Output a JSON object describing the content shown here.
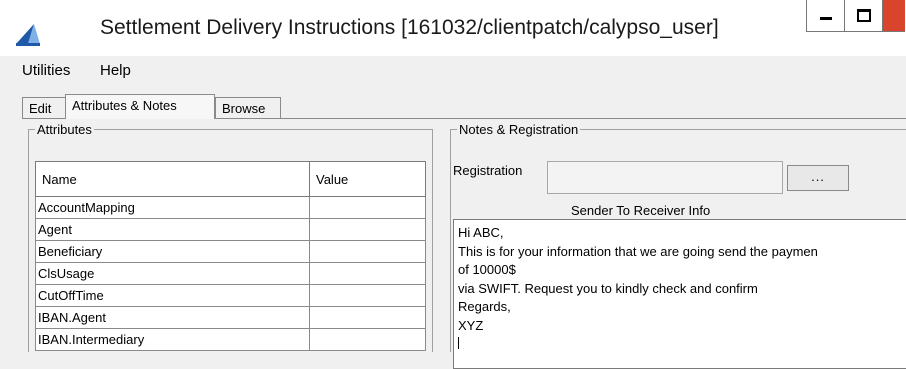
{
  "window": {
    "title": "Settlement Delivery Instructions  [161032/clientpatch/calypso_user]",
    "accent_color": "#1e5aa8",
    "close_color": "#d9452c"
  },
  "menu": {
    "items": [
      "Utilities",
      "Help"
    ]
  },
  "tabs": [
    {
      "label": "Edit",
      "active": false
    },
    {
      "label": "Attributes & Notes",
      "active": true
    },
    {
      "label": "Browse",
      "active": false
    }
  ],
  "attributes": {
    "group_title": "Attributes",
    "columns": [
      "Name",
      "Value"
    ],
    "rows": [
      {
        "name": "AccountMapping",
        "value": ""
      },
      {
        "name": "Agent",
        "value": ""
      },
      {
        "name": "Beneficiary",
        "value": ""
      },
      {
        "name": "ClsUsage",
        "value": ""
      },
      {
        "name": "CutOffTime",
        "value": ""
      },
      {
        "name": "IBAN.Agent",
        "value": ""
      },
      {
        "name": "IBAN.Intermediary",
        "value": ""
      }
    ]
  },
  "notes": {
    "group_title": "Notes & Registration",
    "registration_label": "Registration",
    "registration_value": "",
    "browse_button_label": "...",
    "sender_label": "Sender To Receiver Info",
    "sender_lines": [
      "Hi ABC,",
      "This is for your information that we are going send the paymen",
      "of 10000$",
      "via SWIFT. Request you to kindly check and confirm",
      "Regards,",
      "XYZ"
    ]
  }
}
